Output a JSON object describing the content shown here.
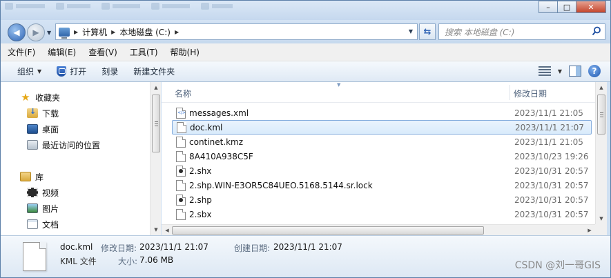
{
  "titlebar": {
    "controls": {
      "minimize": "–",
      "maximize": "□",
      "close": "✕"
    }
  },
  "address": {
    "crumbs": [
      "计算机",
      "本地磁盘 (C:)"
    ],
    "search_placeholder": "搜索 本地磁盘 (C:)"
  },
  "menu": [
    "文件(F)",
    "编辑(E)",
    "查看(V)",
    "工具(T)",
    "帮助(H)"
  ],
  "commands": {
    "organize": "组织",
    "open": "打开",
    "burn": "刻录",
    "new_folder": "新建文件夹"
  },
  "nav": {
    "favorites": "收藏夹",
    "downloads": "下载",
    "desktop": "桌面",
    "recent": "最近访问的位置",
    "libraries": "库",
    "videos": "视频",
    "pictures": "图片",
    "documents": "文档"
  },
  "columns": {
    "name": "名称",
    "modified": "修改日期"
  },
  "files": [
    {
      "name": "messages.xml",
      "date": "2023/11/1 21:05",
      "icon": "xml-file-icon"
    },
    {
      "name": "doc.kml",
      "date": "2023/11/1 21:07",
      "icon": "file-icon",
      "selected": true
    },
    {
      "name": "continet.kmz",
      "date": "2023/11/1 21:05",
      "icon": "file-icon"
    },
    {
      "name": "8A410A938C5F",
      "date": "2023/10/23 19:26",
      "icon": "file-icon"
    },
    {
      "name": "2.shx",
      "date": "2023/10/31 20:57",
      "icon": "shape-file-icon"
    },
    {
      "name": "2.shp.WIN-E3OR5C84UEO.5168.5144.sr.lock",
      "date": "2023/10/31 20:57",
      "icon": "file-icon"
    },
    {
      "name": "2.shp",
      "date": "2023/10/31 20:57",
      "icon": "shape-file-icon"
    },
    {
      "name": "2.sbx",
      "date": "2023/10/31 20:57",
      "icon": "file-icon"
    }
  ],
  "details": {
    "name": "doc.kml",
    "type": "KML 文件",
    "modified_label": "修改日期:",
    "modified_value": "2023/11/1 21:07",
    "created_label": "创建日期:",
    "created_value": "2023/11/1 21:07",
    "size_label": "大小:",
    "size_value": "7.06 MB"
  },
  "watermark": "CSDN @刘一哥GIS"
}
